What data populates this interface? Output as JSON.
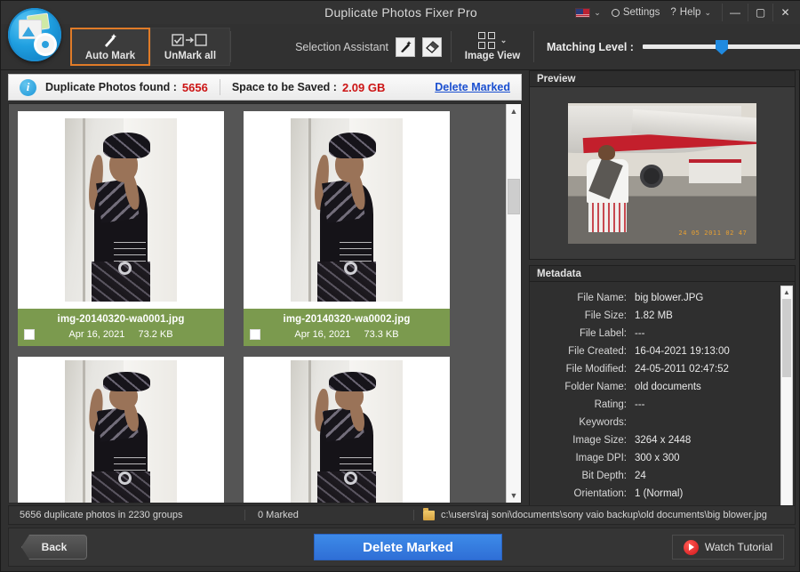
{
  "window": {
    "title": "Duplicate Photos Fixer Pro",
    "controls": {
      "minimize": "—",
      "maximize": "▢",
      "close": "✕"
    }
  },
  "titlebar": {
    "language_flag": "us-flag-icon",
    "settings_label": "Settings",
    "help_label": "Help"
  },
  "toolbar": {
    "auto_mark_label": "Auto Mark",
    "unmark_all_label": "UnMark all",
    "selection_assistant_label": "Selection Assistant",
    "image_view_label": "Image View",
    "matching_level_label": "Matching Level :",
    "matching_level_value": 50
  },
  "infobar": {
    "duplicates_label": "Duplicate Photos found :",
    "duplicates_value": "5656",
    "space_label": "Space to be Saved :",
    "space_value": "2.09 GB",
    "delete_marked_link": "Delete Marked"
  },
  "grid": {
    "cards": [
      {
        "file_name": "img-20140320-wa0001.jpg",
        "date": "Apr 16, 2021",
        "size": "73.2 KB",
        "checked": false
      },
      {
        "file_name": "img-20140320-wa0002.jpg",
        "date": "Apr 16, 2021",
        "size": "73.3 KB",
        "checked": false
      }
    ]
  },
  "preview": {
    "header": "Preview",
    "image_timestamp": "24 05 2011 02 47"
  },
  "metadata": {
    "header": "Metadata",
    "rows": [
      {
        "key": "File Name:",
        "value": "big blower.JPG"
      },
      {
        "key": "File Size:",
        "value": "1.82 MB"
      },
      {
        "key": "File Label:",
        "value": "---"
      },
      {
        "key": "File Created:",
        "value": "16-04-2021 19:13:00"
      },
      {
        "key": "File Modified:",
        "value": "24-05-2011 02:47:52"
      },
      {
        "key": "Folder Name:",
        "value": "old documents"
      },
      {
        "key": "Rating:",
        "value": "---"
      },
      {
        "key": "Keywords:",
        "value": ""
      },
      {
        "key": "Image Size:",
        "value": "3264 x 2448"
      },
      {
        "key": "Image DPI:",
        "value": "300 x 300"
      },
      {
        "key": "Bit Depth:",
        "value": "24"
      },
      {
        "key": "Orientation:",
        "value": "1 (Normal)"
      }
    ]
  },
  "status": {
    "groups_text": "5656 duplicate photos in 2230 groups",
    "marked_text": "0 Marked",
    "path_text": "c:\\users\\raj soni\\documents\\sony vaio backup\\old documents\\big blower.jpg"
  },
  "bottom": {
    "back_label": "Back",
    "delete_marked_label": "Delete Marked",
    "watch_tutorial_label": "Watch Tutorial"
  },
  "colors": {
    "accent_blue": "#3d8ae8",
    "highlight_orange": "#e07b28",
    "label_green": "#7b9a4e",
    "alert_red": "#cc1414",
    "link_blue": "#1a4fd0"
  }
}
